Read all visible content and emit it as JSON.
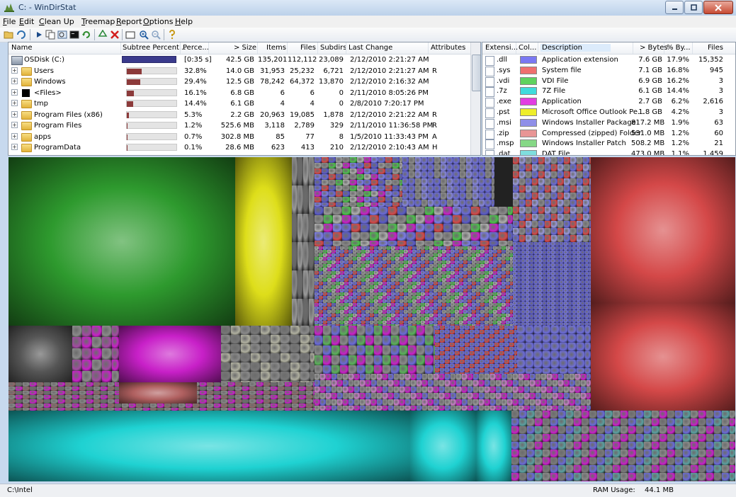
{
  "window": {
    "title": "C: - WinDirStat"
  },
  "menu": [
    {
      "key": "F",
      "rest": "ile"
    },
    {
      "key": "E",
      "rest": "dit"
    },
    {
      "key": "C",
      "rest": "lean Up"
    },
    {
      "key": "T",
      "rest": "reemap"
    },
    {
      "key": "R",
      "rest": "eport"
    },
    {
      "key": "O",
      "rest": "ptions"
    },
    {
      "key": "H",
      "rest": "elp"
    }
  ],
  "toolbar_icons": [
    "open-icon",
    "refresh-all-icon",
    "play-icon",
    "copy-path-icon",
    "explorer-icon",
    "command-prompt-icon",
    "refresh-selected-icon",
    "recycle-icon",
    "delete-icon",
    "new-folder-icon",
    "zoom-in-icon",
    "zoom-out-icon",
    "help-icon"
  ],
  "dirlist": {
    "columns": [
      "Name",
      "Subtree Percent...",
      "Perce...",
      "> Size",
      "Items",
      "Files",
      "Subdirs",
      "Last Change",
      "Attributes"
    ],
    "rows": [
      {
        "name": "OSDisk (C:)",
        "percent": "[0:35 s]",
        "size": "42.5 GB",
        "items": "135,201",
        "files": "112,112",
        "subdirs": "23,089",
        "changed": "2/12/2010  2:21:27 AM",
        "attr": "",
        "fill": 1.0,
        "type": "drive"
      },
      {
        "name": "Users",
        "percent": "32.8%",
        "size": "14.0 GB",
        "items": "31,953",
        "files": "25,232",
        "subdirs": "6,721",
        "changed": "2/12/2010  2:21:27 AM",
        "attr": "R",
        "fill": 0.328,
        "type": "folder"
      },
      {
        "name": "Windows",
        "percent": "29.4%",
        "size": "12.5 GB",
        "items": "78,242",
        "files": "64,372",
        "subdirs": "13,870",
        "changed": "2/12/2010  2:16:32 AM",
        "attr": "",
        "fill": 0.294,
        "type": "folder"
      },
      {
        "name": "<Files>",
        "percent": "16.1%",
        "size": "6.8 GB",
        "items": "6",
        "files": "6",
        "subdirs": "0",
        "changed": "2/11/2010  8:05:26 PM",
        "attr": "",
        "fill": 0.161,
        "type": "files"
      },
      {
        "name": "tmp",
        "percent": "14.4%",
        "size": "6.1 GB",
        "items": "4",
        "files": "4",
        "subdirs": "0",
        "changed": "2/8/2010  7:20:17 PM",
        "attr": "",
        "fill": 0.144,
        "type": "folder"
      },
      {
        "name": "Program Files (x86)",
        "percent": "5.3%",
        "size": "2.2 GB",
        "items": "20,963",
        "files": "19,085",
        "subdirs": "1,878",
        "changed": "2/12/2010  2:21:22 AM",
        "attr": "R",
        "fill": 0.053,
        "type": "folder"
      },
      {
        "name": "Program Files",
        "percent": "1.2%",
        "size": "525.6 MB",
        "items": "3,118",
        "files": "2,789",
        "subdirs": "329",
        "changed": "2/11/2010  11:36:58 PM",
        "attr": "R",
        "fill": 0.012,
        "type": "folder"
      },
      {
        "name": "apps",
        "percent": "0.7%",
        "size": "302.8 MB",
        "items": "85",
        "files": "77",
        "subdirs": "8",
        "changed": "1/5/2010  11:33:43 PM",
        "attr": "A",
        "fill": 0.007,
        "type": "folder"
      },
      {
        "name": "ProgramData",
        "percent": "0.1%",
        "size": "28.6 MB",
        "items": "623",
        "files": "413",
        "subdirs": "210",
        "changed": "2/12/2010  2:10:43 AM",
        "attr": "H",
        "fill": 0.001,
        "type": "folder"
      }
    ]
  },
  "extlist": {
    "columns": [
      "Extensi...",
      "Col...",
      "Description",
      "> Bytes",
      "% By...",
      "Files"
    ],
    "rows": [
      {
        "ext": ".dll",
        "color": "#7a78f2",
        "desc": "Application extension",
        "bytes": "7.6 GB",
        "pct": "17.9%",
        "files": "15,352"
      },
      {
        "ext": ".sys",
        "color": "#ef6f6f",
        "desc": "System file",
        "bytes": "7.1 GB",
        "pct": "16.8%",
        "files": "945"
      },
      {
        "ext": ".vdi",
        "color": "#5fd25f",
        "desc": "VDI File",
        "bytes": "6.9 GB",
        "pct": "16.2%",
        "files": "3"
      },
      {
        "ext": ".7z",
        "color": "#3fdcdc",
        "desc": "7Z File",
        "bytes": "6.1 GB",
        "pct": "14.4%",
        "files": "3"
      },
      {
        "ext": ".exe",
        "color": "#e23ee2",
        "desc": "Application",
        "bytes": "2.7 GB",
        "pct": "6.2%",
        "files": "2,616"
      },
      {
        "ext": ".pst",
        "color": "#eeee2a",
        "desc": "Microsoft Office Outlook Pe...",
        "bytes": "1.8 GB",
        "pct": "4.2%",
        "files": "3"
      },
      {
        "ext": ".msi",
        "color": "#8f8fe8",
        "desc": "Windows Installer Package",
        "bytes": "817.2 MB",
        "pct": "1.9%",
        "files": "63"
      },
      {
        "ext": ".zip",
        "color": "#e89595",
        "desc": "Compressed (zipped) Folder",
        "bytes": "531.0 MB",
        "pct": "1.2%",
        "files": "60"
      },
      {
        "ext": ".msp",
        "color": "#86d886",
        "desc": "Windows Installer Patch",
        "bytes": "508.2 MB",
        "pct": "1.2%",
        "files": "21"
      },
      {
        "ext": ".dat",
        "color": "#7fdede",
        "desc": "DAT File",
        "bytes": "473.0 MB",
        "pct": "1.1%",
        "files": "1,459"
      }
    ]
  },
  "status": {
    "path": "C:\\Intel",
    "ram_label": "RAM Usage:",
    "ram_value": "44.1 MB"
  },
  "treemap_colors": {
    "vdi": "#2e9a2e",
    "pst": "#dede1a",
    "sys": "#d44848",
    "dat": "#1fd2d2",
    "dll": "#6a6ad8",
    "exe": "#c820c8",
    "grey": "#8a8a8a"
  }
}
